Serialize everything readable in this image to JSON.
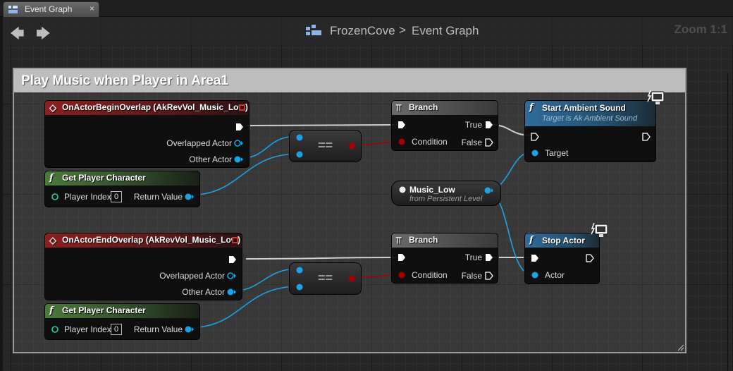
{
  "tab": {
    "label": "Event Graph",
    "close": "×"
  },
  "breadcrumb": {
    "project": "FrozenCove",
    "separator": ">",
    "graph": "Event Graph"
  },
  "zoom": "Zoom 1:1",
  "comment": {
    "title": "Play Music when Player in Area1"
  },
  "nodes": {
    "begin_overlap": {
      "title": "OnActorBeginOverlap (AkRevVol_Music_Low)",
      "pins": [
        "Overlapped Actor",
        "Other Actor"
      ]
    },
    "get_player_1": {
      "title": "Get Player Character",
      "input": "Player Index",
      "input_value": "0",
      "output": "Return Value"
    },
    "equal_1": {
      "symbol": "=="
    },
    "branch_1": {
      "title": "Branch",
      "condition": "Condition",
      "true": "True",
      "false": "False"
    },
    "start_ambient": {
      "title": "Start Ambient Sound",
      "subtitle": "Target is Ak Ambient Sound",
      "target": "Target"
    },
    "music_low": {
      "name": "Music_Low",
      "sub": "from Persistent Level"
    },
    "end_overlap": {
      "title": "OnActorEndOverlap (AkRevVol_Music_Low)",
      "pins": [
        "Overlapped Actor",
        "Other Actor"
      ]
    },
    "get_player_2": {
      "title": "Get Player Character",
      "input": "Player Index",
      "input_value": "0",
      "output": "Return Value"
    },
    "equal_2": {
      "symbol": "=="
    },
    "branch_2": {
      "title": "Branch",
      "condition": "Condition",
      "true": "True",
      "false": "False"
    },
    "stop_actor": {
      "title": "Stop Actor",
      "target": "Actor"
    }
  },
  "icons": {
    "tab": "graph-tab-icon",
    "back": "back-arrow-icon",
    "forward": "forward-arrow-icon",
    "blueprint": "blueprint-grid-icon",
    "event": "event-diamond-icon",
    "function": "function-f-icon",
    "branch": "branch-icon",
    "authority": "authority-badge-icon"
  },
  "colors": {
    "exec": "#ffffff",
    "object": "#1aa3e6",
    "bool": "#a50000",
    "event_header": "#8c1f1f",
    "pure_header": "#4d7a3c",
    "function_header": "#2f6c9c",
    "comment": "#bdbdbd"
  }
}
